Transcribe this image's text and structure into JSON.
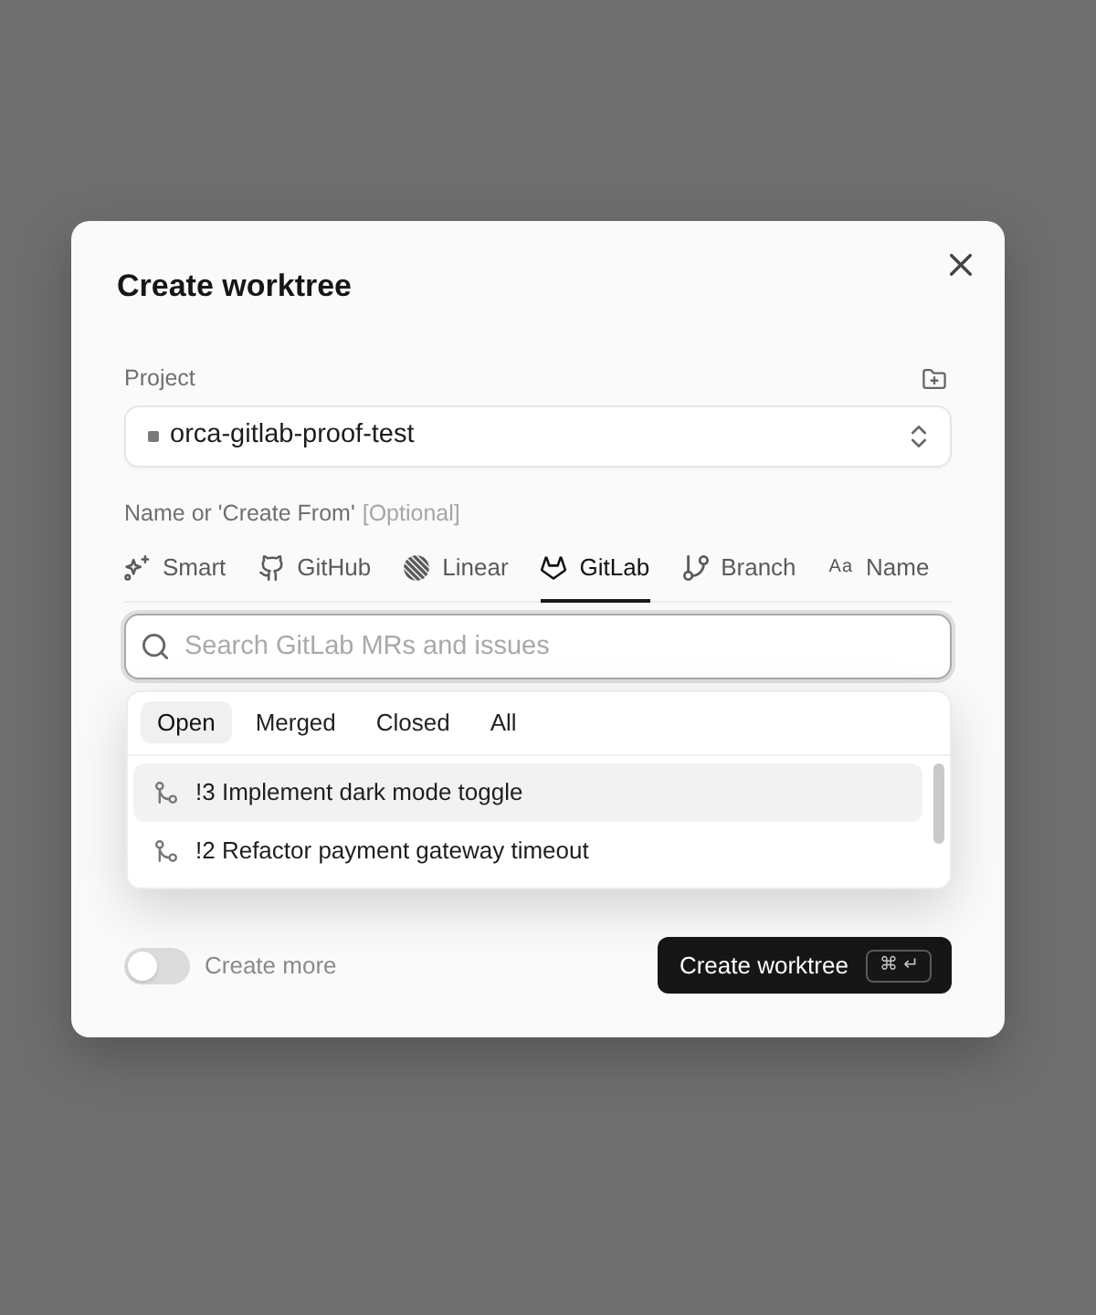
{
  "dialog": {
    "title": "Create worktree"
  },
  "project": {
    "label": "Project",
    "value": "orca-gitlab-proof-test"
  },
  "source": {
    "label": "Name or 'Create From'",
    "hint": "[Optional]",
    "tabs": [
      {
        "kind": "smart",
        "label": "Smart",
        "selected": false
      },
      {
        "kind": "github",
        "label": "GitHub",
        "selected": false
      },
      {
        "kind": "linear",
        "label": "Linear",
        "selected": false
      },
      {
        "kind": "gitlab",
        "label": "GitLab",
        "selected": true
      },
      {
        "kind": "branch",
        "label": "Branch",
        "selected": false
      },
      {
        "kind": "text",
        "glyph": "Aa",
        "label": "Name",
        "selected": false
      }
    ]
  },
  "search": {
    "placeholder": "Search GitLab MRs and issues"
  },
  "filters": [
    {
      "label": "Open",
      "selected": true
    },
    {
      "label": "Merged",
      "selected": false
    },
    {
      "label": "Closed",
      "selected": false
    },
    {
      "label": "All",
      "selected": false
    }
  ],
  "results": [
    {
      "label": "!3 Implement dark mode toggle",
      "selected": true
    },
    {
      "label": "!2 Refactor payment gateway timeout",
      "selected": false
    }
  ],
  "create_more": {
    "label": "Create more",
    "on": false
  },
  "submit": {
    "label": "Create worktree",
    "shortcut": "⌘ ↵"
  }
}
